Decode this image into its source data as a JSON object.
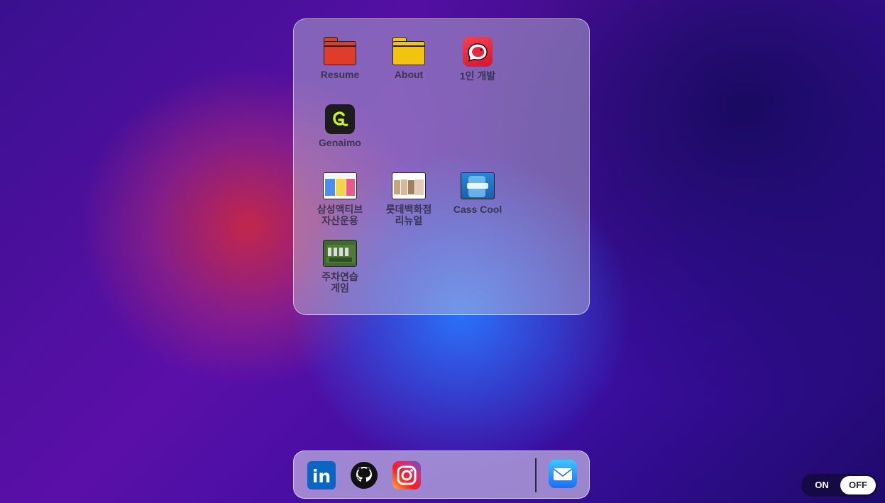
{
  "colors": {
    "folder_resume": "#e03c2b",
    "folder_about": "#f2c40f",
    "genaimo_bg": "#1c1c1c",
    "genaimo_accent": "#c9ef2b",
    "app_1in_bg": "#e8263e",
    "label_text": "#3a3550"
  },
  "apps": [
    {
      "label": "Resume",
      "icon": "folder-icon"
    },
    {
      "label": "About",
      "icon": "folder-icon"
    },
    {
      "label": "1인 개발",
      "icon": "app-icon"
    },
    {
      "label": "Genaimo",
      "icon": "genaimo-icon"
    },
    {
      "label": "삼성액티브\n자산운용",
      "icon": "thumbnail"
    },
    {
      "label": "롯데백화점\n리뉴얼",
      "icon": "thumbnail"
    },
    {
      "label": "Cass Cool",
      "icon": "thumbnail"
    },
    {
      "label": "주차연습\n게임",
      "icon": "thumbnail"
    }
  ],
  "dock": {
    "items": [
      {
        "icon": "linkedin-icon",
        "text": "in"
      },
      {
        "icon": "github-icon"
      },
      {
        "icon": "instagram-icon"
      },
      {
        "icon": "mail-icon"
      }
    ]
  },
  "toggle": {
    "on_label": "ON",
    "off_label": "OFF",
    "state": "off"
  }
}
